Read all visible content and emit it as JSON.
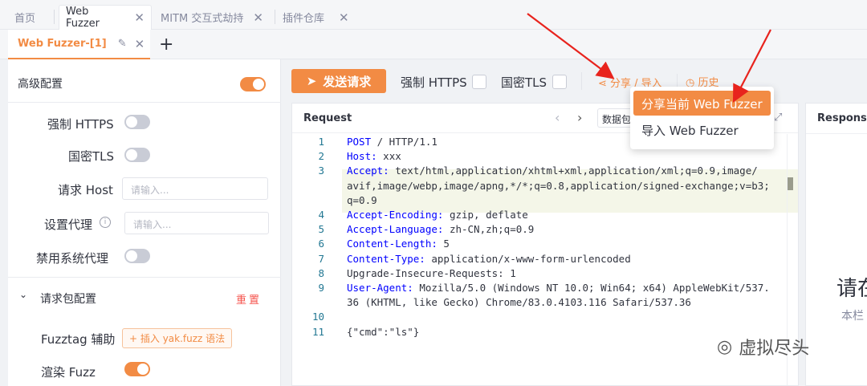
{
  "top_tabs": [
    {
      "label": "首页"
    },
    {
      "label": "Web Fuzzer"
    },
    {
      "label": "MITM 交互式劫持"
    },
    {
      "label": "插件仓库"
    }
  ],
  "sub_tab": {
    "label": "Web Fuzzer-[1]"
  },
  "left_panel": {
    "advanced_config": "高级配置",
    "force_https": "强制 HTTPS",
    "gm_tls": "国密TLS",
    "request_host": "请求 Host",
    "request_host_placeholder": "请输入...",
    "set_proxy": "设置代理",
    "set_proxy_placeholder": "请输入...",
    "disable_system_proxy": "禁用系统代理",
    "packet_config": "请求包配置",
    "reset": "重置",
    "fuzztag_helper": "Fuzztag 辅助",
    "insert_fuzz": "插入 yak.fuzz 语法",
    "render_fuzz": "渲染 Fuzz"
  },
  "toolbar": {
    "send": "发送请求",
    "force_https": "强制 HTTPS",
    "gm_tls": "国密TLS",
    "share_import": "分享 / 导入",
    "history": "历史"
  },
  "dropdown": {
    "share_current": "分享当前 Web Fuzzer",
    "import": "导入 Web Fuzzer"
  },
  "editor": {
    "title": "Request",
    "packet_btn": "数据包"
  },
  "request_lines": [
    {
      "n": "1",
      "key": "POST",
      "val": " / HTTP/1.1"
    },
    {
      "n": "2",
      "key": "Host:",
      "val": " xxx"
    },
    {
      "n": "3",
      "key": "Accept:",
      "val": " text/html,application/xhtml+xml,application/xml;q=0.9,image/"
    },
    {
      "n": "",
      "key": "",
      "val": "avif,image/webp,image/apng,*/*;q=0.8,application/signed-exchange;v=b3;"
    },
    {
      "n": "",
      "key": "",
      "val": "q=0.9"
    },
    {
      "n": "4",
      "key": "Accept-Encoding:",
      "val": " gzip, deflate"
    },
    {
      "n": "5",
      "key": "Accept-Language:",
      "val": " zh-CN,zh;q=0.9"
    },
    {
      "n": "6",
      "key": "Content-Length:",
      "val": " 5"
    },
    {
      "n": "7",
      "key": "Content-Type:",
      "val": " application/x-www-form-urlencoded"
    },
    {
      "n": "8",
      "key": "",
      "val": "Upgrade-Insecure-Requests: 1"
    },
    {
      "n": "9",
      "key": "User-Agent:",
      "val": " Mozilla/5.0 (Windows NT 10.0; Win64; x64) AppleWebKit/537."
    },
    {
      "n": "",
      "key": "",
      "val": "36 (KHTML, like Gecko) Chrome/83.0.4103.116 Safari/537.36"
    },
    {
      "n": "10",
      "key": "",
      "val": ""
    },
    {
      "n": "11",
      "key": "",
      "val": "{\"cmd\":\"ls\"}"
    }
  ],
  "response": {
    "title": "Responses",
    "big_text": "请在",
    "small_text": "本栏"
  },
  "watermark": "虚拟尽头",
  "colors": {
    "accent": "#f28b44",
    "arrow": "#e8231d"
  }
}
